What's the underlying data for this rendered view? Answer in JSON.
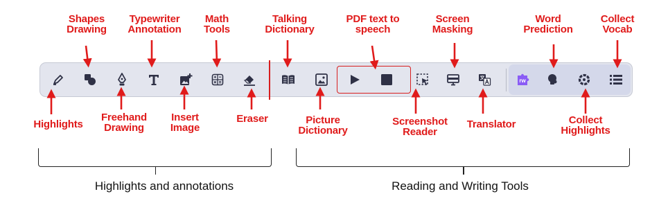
{
  "toolbar": {
    "highlights_group": {
      "tools": [
        {
          "id": "highlights",
          "icon": "highlighter-icon",
          "label": "Highlights"
        },
        {
          "id": "shapes-drawing",
          "icon": "shapes-icon",
          "label": "Shapes\nDrawing"
        },
        {
          "id": "freehand-drawing",
          "icon": "pen-nib-icon",
          "label": "Freehand\nDrawing"
        },
        {
          "id": "typewriter-annotation",
          "icon": "typewriter-t-icon",
          "label": "Typewriter\nAnnotation"
        },
        {
          "id": "insert-image",
          "icon": "insert-image-icon",
          "label": "Insert\nImage"
        },
        {
          "id": "math-tools",
          "icon": "calculator-icon",
          "label": "Math\nTools"
        },
        {
          "id": "eraser",
          "icon": "eraser-icon",
          "label": "Eraser"
        }
      ],
      "group_label": "Highlights and annotations"
    },
    "reading_group": {
      "tools": [
        {
          "id": "talking-dictionary",
          "icon": "book-open-icon",
          "label": "Talking\nDictionary"
        },
        {
          "id": "picture-dictionary",
          "icon": "picture-icon",
          "label": "Picture\nDictionary"
        },
        {
          "id": "pdf-text-to-speech-play",
          "icon": "play-icon",
          "label": "PDF text to\nspeech"
        },
        {
          "id": "pdf-text-to-speech-stop",
          "icon": "stop-icon",
          "label": ""
        },
        {
          "id": "screenshot-reader",
          "icon": "screenshot-select-icon",
          "label": "Screenshot\nReader"
        },
        {
          "id": "screen-masking",
          "icon": "screen-mask-icon",
          "label": "Screen\nMasking"
        },
        {
          "id": "translator",
          "icon": "translate-icon",
          "label": "Translator"
        },
        {
          "id": "word-prediction",
          "icon": "rw-puzzle-icon",
          "label": "Word\nPrediction",
          "badge": "rw"
        },
        {
          "id": "collect-highlights",
          "icon": "lightbulb-icon",
          "label": "Collect\nHighlights"
        },
        {
          "id": "collect-vocab",
          "icon": "gear-ring-icon",
          "label": "Collect\nVocab"
        },
        {
          "id": "menu",
          "icon": "list-icon",
          "label": ""
        }
      ],
      "group_label": "Reading and Writing Tools"
    }
  },
  "labels": {
    "highlights": "Highlights",
    "shapes_drawing": "Shapes\nDrawing",
    "freehand_drawing": "Freehand\nDrawing",
    "typewriter_annotation": "Typewriter\nAnnotation",
    "insert_image": "Insert\nImage",
    "math_tools": "Math\nTools",
    "eraser": "Eraser",
    "talking_dictionary": "Talking\nDictionary",
    "picture_dictionary": "Picture\nDictionary",
    "pdf_text_to_speech": "PDF text to\nspeech",
    "screenshot_reader": "Screenshot\nReader",
    "screen_masking": "Screen\nMasking",
    "translator": "Translator",
    "word_prediction": "Word\nPrediction",
    "collect_highlights": "Collect\nHighlights",
    "collect_vocab": "Collect\nVocab",
    "rw_badge": "rw"
  },
  "groups": {
    "highlights_and_annotations": "Highlights and annotations",
    "reading_and_writing_tools": "Reading and Writing Tools"
  },
  "colors": {
    "annotation_red": "#e01b1b",
    "toolbar_bg": "#e3e5ee",
    "icon": "#2f3146",
    "rw_purple": "#8a5cf5"
  }
}
